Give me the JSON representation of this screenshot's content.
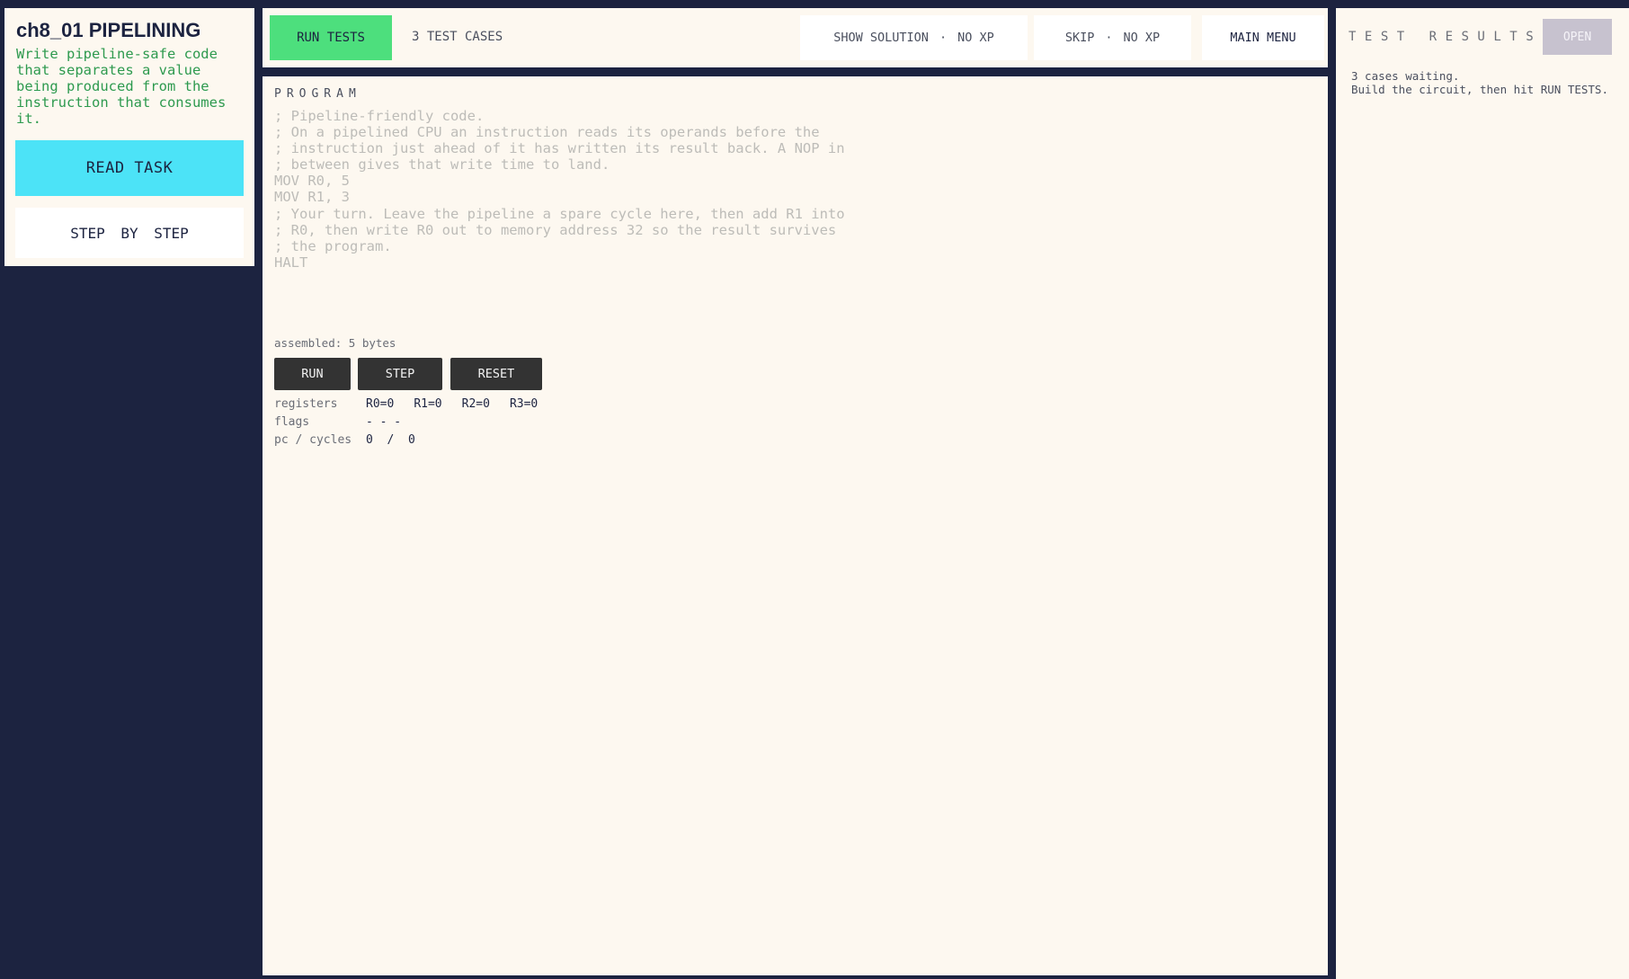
{
  "task": {
    "title": "ch8_01 PIPELINING",
    "description": "Write pipeline-safe code that separates a value being produced from the instruction that consumes it.",
    "read_task_label": "READ TASK",
    "step_by_step_label": "STEP  BY  STEP"
  },
  "toolbar": {
    "run_tests_label": "RUN TESTS",
    "test_cases_label": "3 TEST CASES",
    "show_solution_label": "SHOW SOLUTION",
    "show_solution_note": "NO XP",
    "skip_label": "SKIP",
    "skip_note": "NO XP",
    "separator": "·",
    "main_menu_label": "MAIN MENU"
  },
  "program": {
    "section_label": "PROGRAM",
    "code": "; Pipeline-friendly code.\n; On a pipelined CPU an instruction reads its operands before the\n; instruction just ahead of it has written its result back. A NOP in\n; between gives that write time to land.\nMOV R0, 5\nMOV R1, 3\n; Your turn. Leave the pipeline a spare cycle here, then add R1 into\n; R0, then write R0 out to memory address 32 so the result survives\n; the program.\nHALT",
    "assembled_label": "assembled: 5 bytes",
    "run_label": "RUN",
    "step_label": "STEP",
    "reset_label": "RESET"
  },
  "state": {
    "registers_label": "registers",
    "registers": [
      "R0=0",
      "R1=0",
      "R2=0",
      "R3=0"
    ],
    "flags_label": "flags",
    "flags_value": "- - -",
    "pc_label": "pc / cycles",
    "pc_value": "0  /  0"
  },
  "results": {
    "title": "TEST RESULTS",
    "open_label": "OPEN",
    "status_line1": "3 cases waiting.",
    "status_line2": "Build the circuit, then hit RUN TESTS."
  },
  "colors": {
    "background": "#1c2340",
    "panel": "#fdf8f0",
    "accent_cyan": "#4ce3f7",
    "accent_green": "#4ddf7d",
    "description_green": "#2e9a4f"
  }
}
